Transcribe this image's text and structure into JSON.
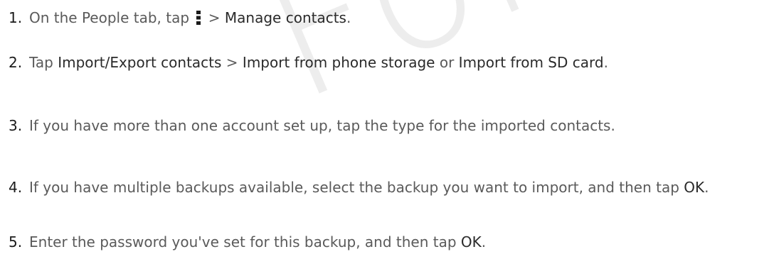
{
  "watermark": "For c",
  "steps": [
    {
      "number": "1.",
      "parts": [
        "On the People tab, tap ",
        "menu-dots-icon",
        " > ",
        "Manage contacts",
        "."
      ]
    },
    {
      "number": "2.",
      "parts": [
        "Tap ",
        "Import/Export contacts",
        " > ",
        "Import from phone storage",
        " or ",
        "Import from SD card",
        "."
      ]
    },
    {
      "number": "3.",
      "parts": [
        "If you have more than one account set up, tap the type for the imported contacts."
      ]
    },
    {
      "number": "4.",
      "parts": [
        "If you have multiple backups available, select the backup you want to import, and then tap ",
        "OK",
        "."
      ]
    },
    {
      "number": "5.",
      "parts": [
        "Enter the password you've set for this backup, and then tap ",
        "OK",
        "."
      ]
    }
  ]
}
